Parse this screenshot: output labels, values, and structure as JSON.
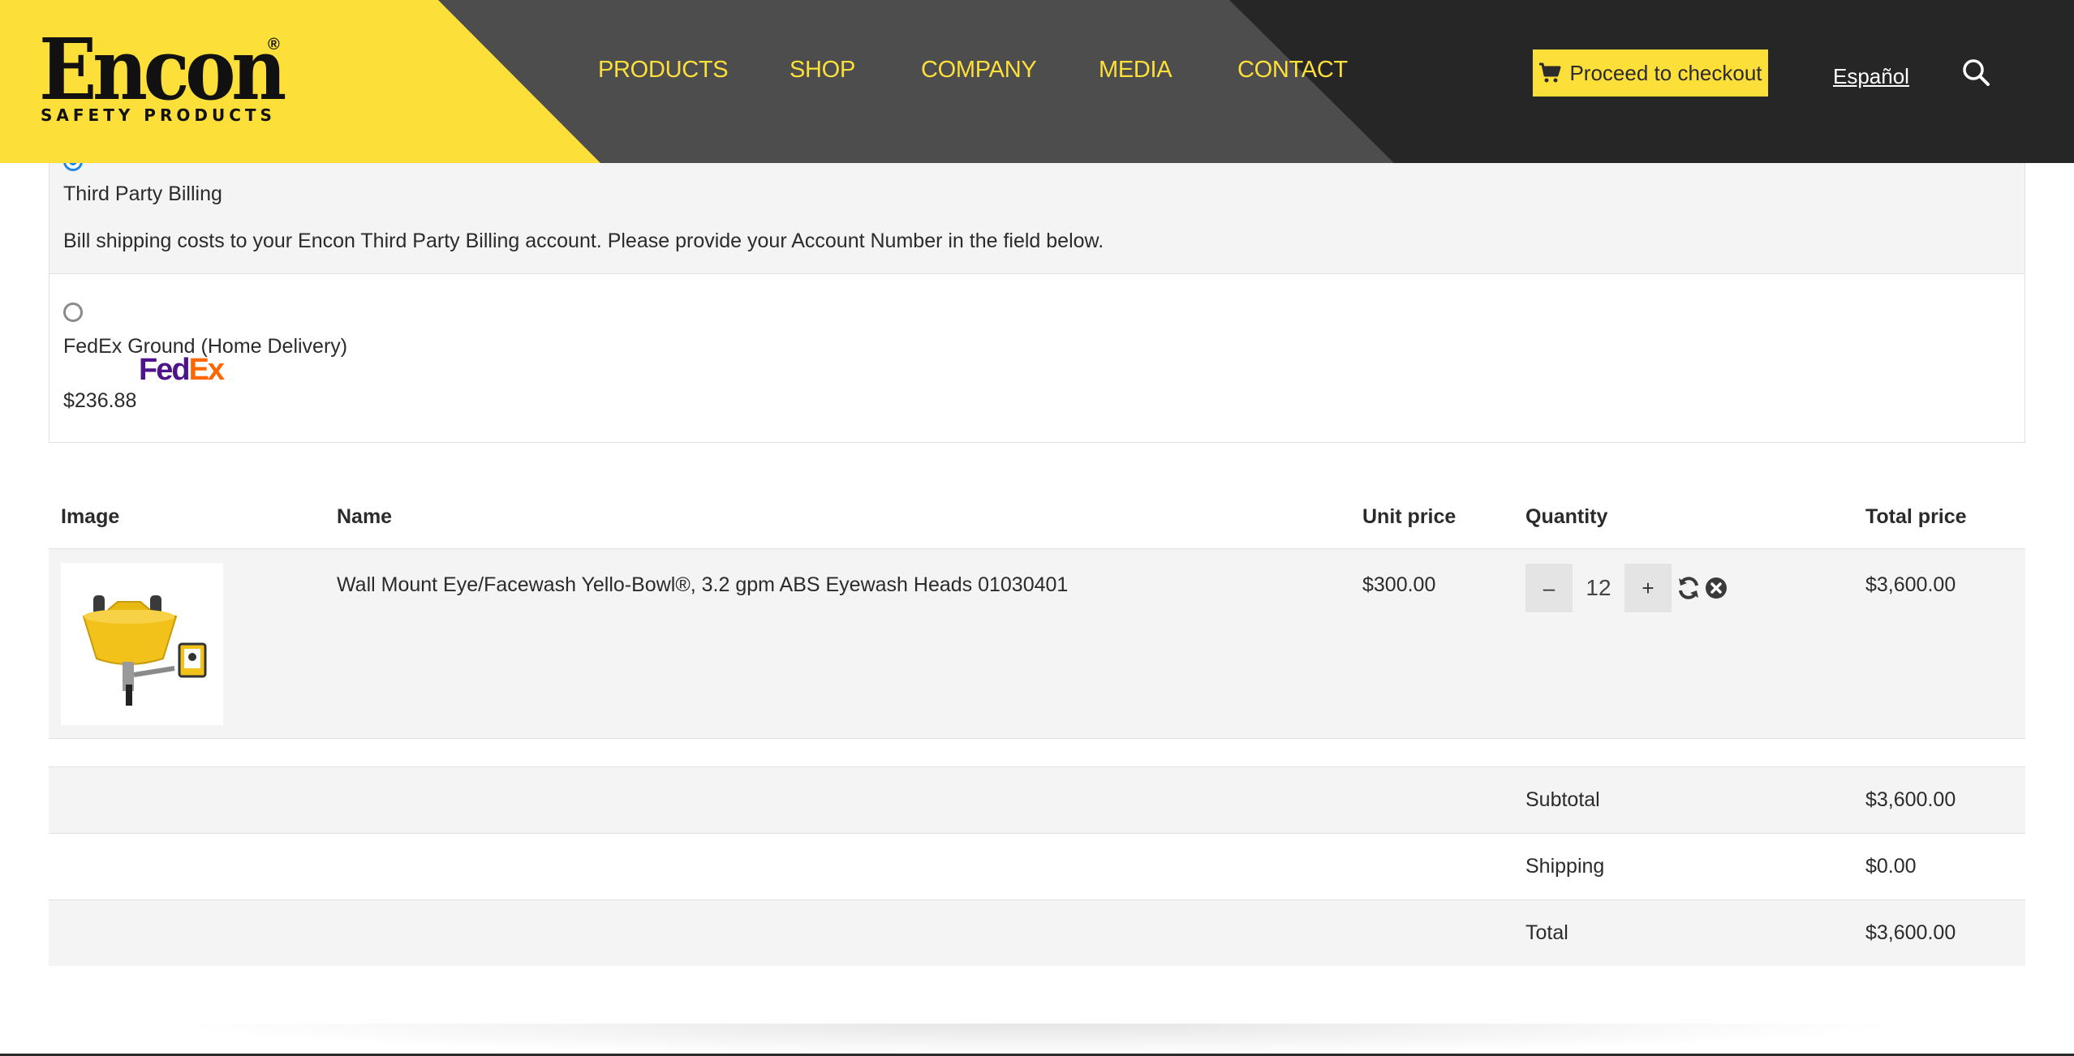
{
  "brand": {
    "name": "Encon",
    "registered": "®",
    "tagline": "SAFETY PRODUCTS",
    "colors": {
      "yellow": "#fddf3a",
      "dark": "#262626",
      "mid": "#4d4d4d"
    }
  },
  "nav": {
    "items": [
      {
        "label": "PRODUCTS"
      },
      {
        "label": "SHOP"
      },
      {
        "label": "COMPANY"
      },
      {
        "label": "MEDIA"
      },
      {
        "label": "CONTACT"
      }
    ]
  },
  "header": {
    "checkout_label": "Proceed to checkout",
    "checkout_icon": "cart-icon",
    "language_link": "Español",
    "search_icon": "search-icon"
  },
  "shipping": {
    "options": [
      {
        "title": "Third Party Billing",
        "description": "Bill shipping costs to your Encon Third Party Billing account. Please provide your Account Number in the field below.",
        "selected": true
      },
      {
        "title": "FedEx Ground (Home Delivery)",
        "price": "$236.88",
        "carrier_logo": {
          "part1": "Fed",
          "part2": "Ex"
        },
        "selected": false
      }
    ]
  },
  "cart": {
    "headers": {
      "image": "Image",
      "name": "Name",
      "unit_price": "Unit price",
      "quantity": "Quantity",
      "total_price": "Total price"
    },
    "items": [
      {
        "name": "Wall Mount Eye/Facewash Yello-Bowl®, 3.2 gpm ABS Eyewash Heads 01030401",
        "unit_price": "$300.00",
        "quantity": "12",
        "total_price": "$3,600.00",
        "decrement_label": "–",
        "increment_label": "+",
        "update_icon": "refresh-icon",
        "remove_icon": "remove-circle-icon"
      }
    ]
  },
  "totals": {
    "subtotal_label": "Subtotal",
    "subtotal": "$3,600.00",
    "shipping_label": "Shipping",
    "shipping": "$0.00",
    "total_label": "Total",
    "total": "$3,600.00"
  }
}
